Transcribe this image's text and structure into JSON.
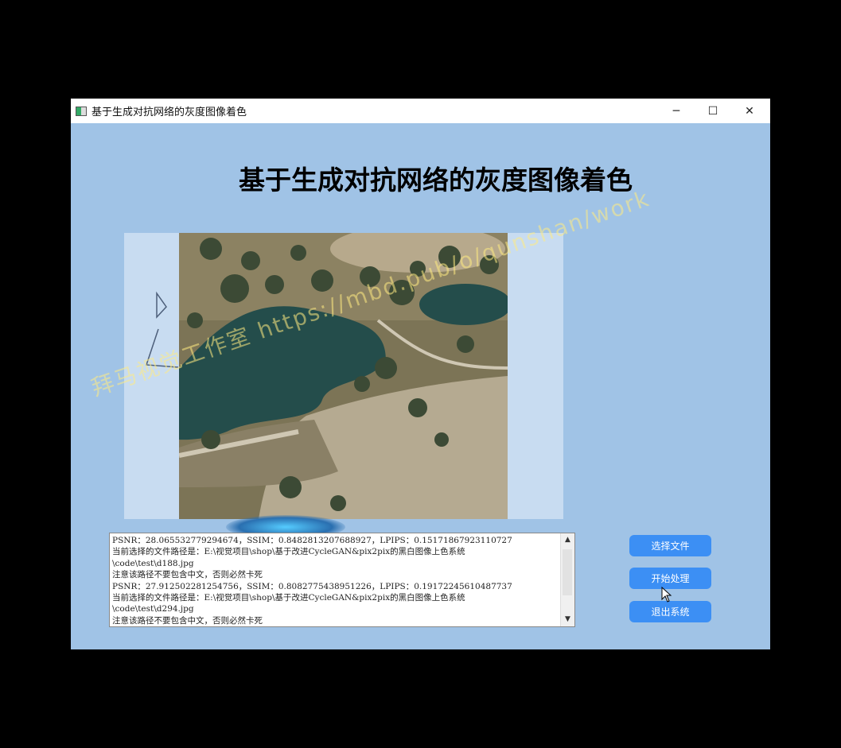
{
  "window": {
    "title": "基于生成对抗网络的灰度图像着色",
    "controls": {
      "minimize": "─",
      "maximize": "☐",
      "close": "✕"
    }
  },
  "main": {
    "heading": "基于生成对抗网络的灰度图像着色"
  },
  "log": {
    "lines": [
      "PSNR：28.065532779294674，SSIM：0.8482813207688927，LPIPS：0.15171867923110727",
      "当前选择的文件路径是：E:\\视觉项目\\shop\\基于改进CycleGAN&pix2pix的黑白图像上色系统",
      "\\code\\test\\d188.jpg",
      "注意该路径不要包含中文，否则必然卡死",
      "PSNR：27.912502281254756，SSIM：0.8082775438951226，LPIPS：0.19172245610487737",
      "当前选择的文件路径是：E:\\视觉项目\\shop\\基于改进CycleGAN&pix2pix的黑白图像上色系统",
      "\\code\\test\\d294.jpg",
      "注意该路径不要包含中文，否则必然卡死"
    ]
  },
  "buttons": {
    "select_file": "选择文件",
    "start_process": "开始处理",
    "exit": "退出系统"
  },
  "watermark": "拜马视觉工作室 https://mbd.pub/o/qunshan/work",
  "icons": {
    "app": "app-icon",
    "cursor": "cursor-icon"
  },
  "colors": {
    "window_bg": "#a0c3e6",
    "button": "#3c8ff4"
  }
}
